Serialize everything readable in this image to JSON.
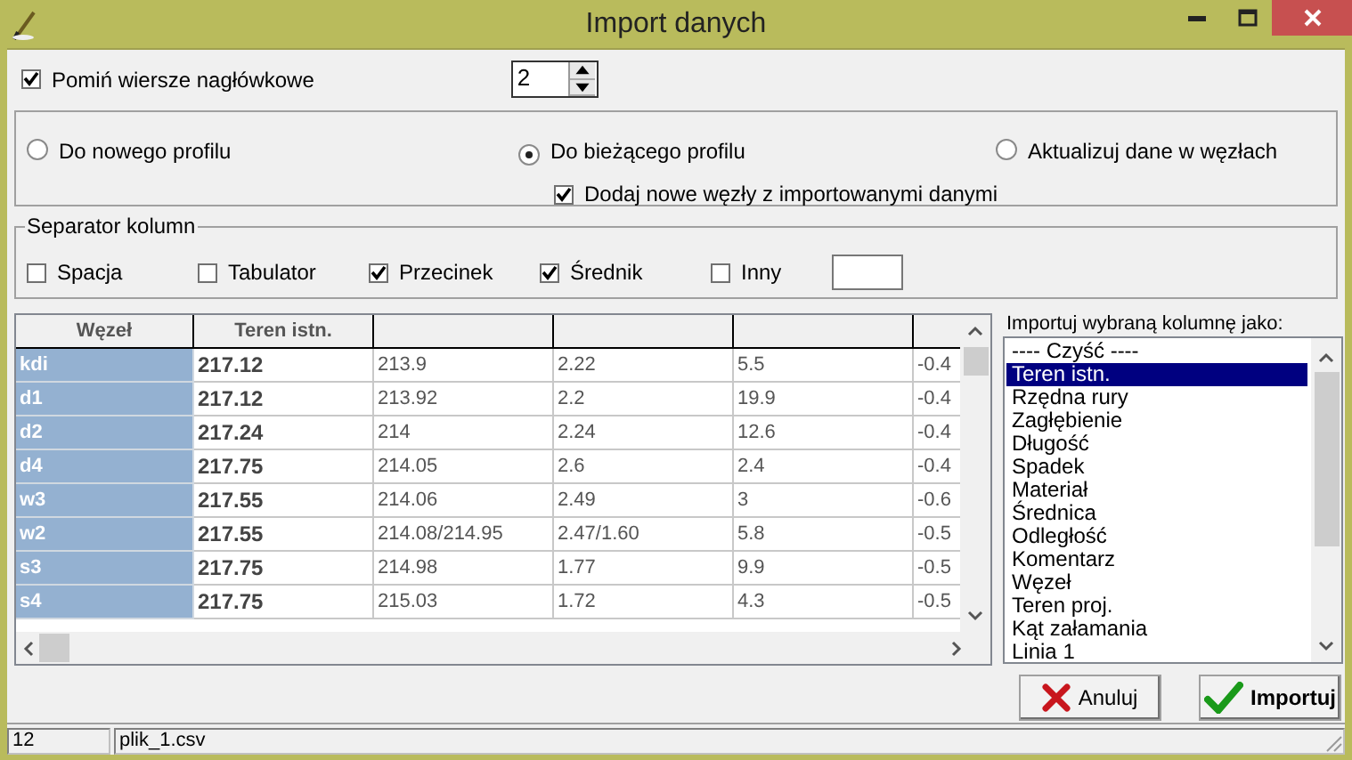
{
  "window": {
    "title": "Import danych"
  },
  "skip_header_rows": {
    "label": "Pomiń wiersze nagłówkowe",
    "checked": true,
    "value": "2"
  },
  "target": {
    "options": [
      {
        "label": "Do nowego profilu",
        "selected": false
      },
      {
        "label": "Do bieżącego profilu",
        "selected": true
      },
      {
        "label": "Aktualizuj dane w węzłach",
        "selected": false
      }
    ],
    "add_nodes": {
      "label": "Dodaj nowe węzły z importowanymi danymi",
      "checked": true
    }
  },
  "separator": {
    "title": "Separator kolumn",
    "options": [
      {
        "label": "Spacja",
        "checked": false
      },
      {
        "label": "Tabulator",
        "checked": false
      },
      {
        "label": "Przecinek",
        "checked": true
      },
      {
        "label": "Średnik",
        "checked": true
      },
      {
        "label": "Inny",
        "checked": false
      }
    ]
  },
  "table": {
    "columns": [
      "Węzeł",
      "Teren istn."
    ],
    "rows": [
      [
        "kdi",
        "217.12",
        "213.9",
        "2.22",
        "5.5",
        "-0.4"
      ],
      [
        "d1",
        "217.12",
        "213.92",
        "2.2",
        "19.9",
        "-0.4"
      ],
      [
        "d2",
        "217.24",
        "214",
        "2.24",
        "12.6",
        "-0.4"
      ],
      [
        "d4",
        "217.75",
        "214.05",
        "2.6",
        "2.4",
        "-0.4"
      ],
      [
        "w3",
        "217.55",
        "214.06",
        "2.49",
        "3",
        "-0.6"
      ],
      [
        "w2",
        "217.55",
        "214.08/214.95",
        "2.47/1.60",
        "5.8",
        "-0.5"
      ],
      [
        "s3",
        "217.75",
        "214.98",
        "1.77",
        "9.9",
        "-0.5"
      ],
      [
        "s4",
        "217.75",
        "215.03",
        "1.72",
        "4.3",
        "-0.5"
      ]
    ]
  },
  "column_type": {
    "label": "Importuj wybraną kolumnę jako:",
    "items": [
      {
        "label": "---- Czyść ----",
        "selected": false
      },
      {
        "label": "Teren istn.",
        "selected": true
      },
      {
        "label": "Rzędna rury",
        "selected": false
      },
      {
        "label": "Zagłębienie",
        "selected": false
      },
      {
        "label": "Długość",
        "selected": false
      },
      {
        "label": "Spadek",
        "selected": false
      },
      {
        "label": "Materiał",
        "selected": false
      },
      {
        "label": "Średnica",
        "selected": false
      },
      {
        "label": "Odległość",
        "selected": false
      },
      {
        "label": "Komentarz",
        "selected": false
      },
      {
        "label": "Węzeł",
        "selected": false
      },
      {
        "label": "Teren proj.",
        "selected": false
      },
      {
        "label": "Kąt załamania",
        "selected": false
      },
      {
        "label": "Linia 1",
        "selected": false
      }
    ]
  },
  "buttons": [
    {
      "label": "Anuluj",
      "kind": "cancel"
    },
    {
      "label": "Importuj",
      "kind": "confirm"
    }
  ],
  "status_bar": [
    "12",
    "plik_1.csv"
  ]
}
